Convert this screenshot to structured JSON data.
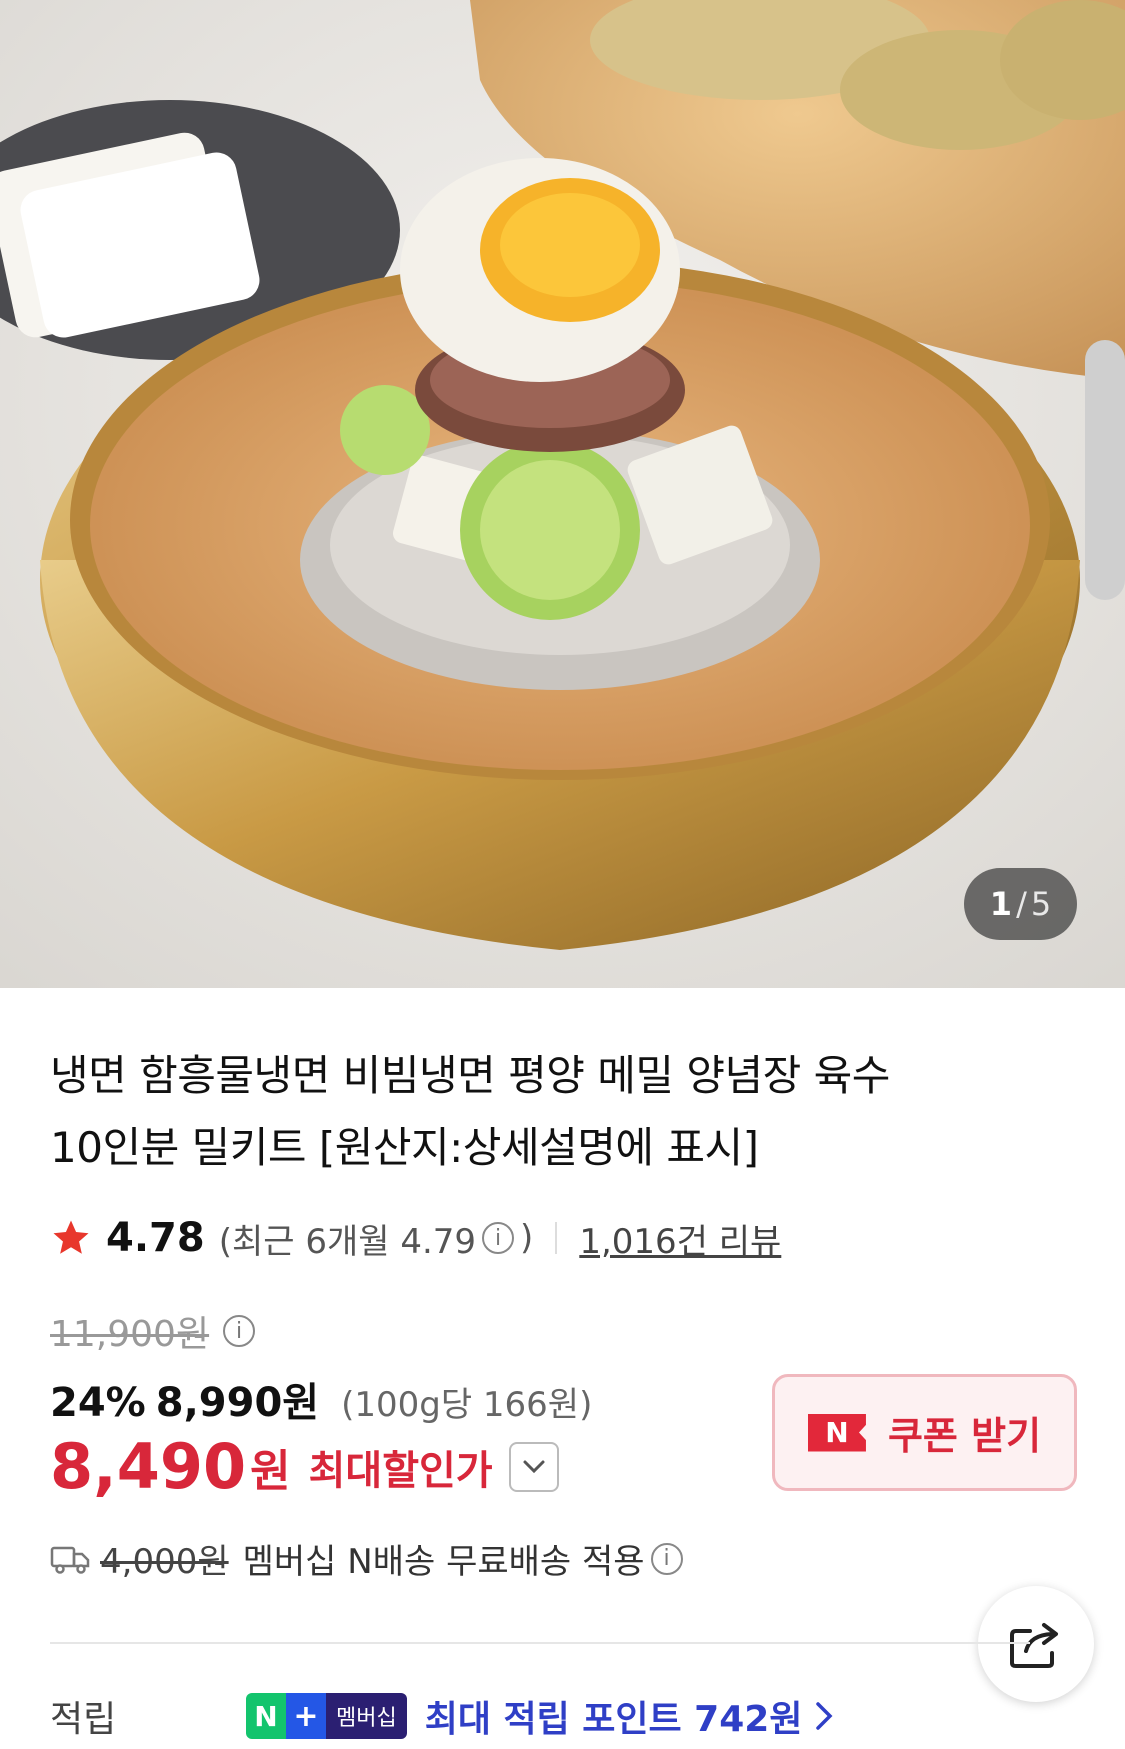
{
  "gallery": {
    "current": "1",
    "separator": "/",
    "total": "5"
  },
  "product": {
    "title_line1": "냉면 함흥물냉면 비빔냉면 평양 메밀 양념장 육수",
    "title_line2": "10인분 밀키트 [원산지:상세설명에 표시]"
  },
  "rating": {
    "score": "4.78",
    "recent_prefix": "(최근 6개월 4.79",
    "recent_suffix": ")",
    "reviews": "1,016건 리뷰"
  },
  "price": {
    "original": "11,900원",
    "discount_pct": "24%",
    "sale": "8,990원",
    "unit_price": "(100g당 166원)",
    "final": "8,490",
    "final_won": "원",
    "final_label": "최대할인가"
  },
  "coupon": {
    "badge": "N",
    "label": "쿠폰 받기"
  },
  "shipping": {
    "fee": "4,000원",
    "text": "멤버십 N배송 무료배송 적용"
  },
  "points": {
    "label": "적립",
    "badge_n": "N",
    "badge_plus": "+",
    "badge_mem": "멤버십",
    "text": "최대 적립 포인트 742원"
  },
  "colors": {
    "accent_red": "#d8273a",
    "points_blue": "#2f3fc6",
    "star": "#e8372c"
  },
  "icons": [
    "star-icon",
    "info-icon",
    "chevron-down-icon",
    "truck-icon",
    "share-icon",
    "chevron-right-icon"
  ]
}
